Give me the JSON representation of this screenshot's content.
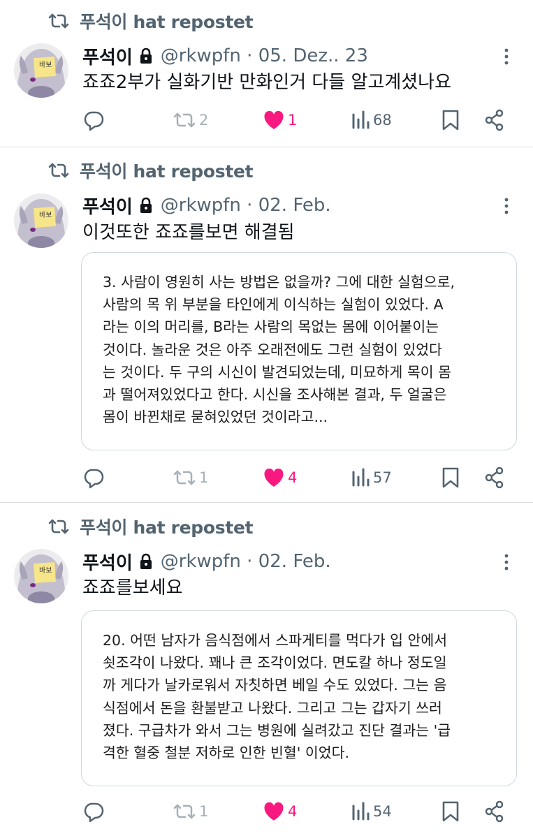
{
  "posts": [
    {
      "repost_label": "푸석이 hat repostet",
      "name": "푸석이",
      "handle": "@rkwpfn · 05. Dez.. 23",
      "text": "죠죠2부가 실화기반 만화인거 다들 알고계셨나요",
      "quote": [],
      "retweets": "2",
      "likes": "1",
      "views": "68",
      "liked": true
    },
    {
      "repost_label": "푸석이 hat repostet",
      "name": "푸석이",
      "handle": "@rkwpfn · 02. Feb.",
      "text": "이것또한 죠죠를보면 해결됨",
      "quote": [
        "3. 사람이 영원히 사는 방법은 없을까? 그에 대한 실험으로,",
        "사람의 목 위 부분을 타인에게 이식하는 실험이 있었다. A",
        "라는 이의 머리를, B라는 사람의 목없는 몸에 이어붙이는",
        "것이다. 놀라운 것은 아주 오래전에도 그런 실험이 있었다",
        "는 것이다. 두 구의 시신이 발견되었는데, 미묘하게 목이 몸",
        "과 떨어져있었다고 한다. 시신을 조사해본 결과, 두 얼굴은",
        "몸이 바뀐채로 묻혀있었던 것이라고..."
      ],
      "retweets": "1",
      "likes": "4",
      "views": "57",
      "liked": true
    },
    {
      "repost_label": "푸석이 hat repostet",
      "name": "푸석이",
      "handle": "@rkwpfn · 02. Feb.",
      "text": "죠죠를보세요",
      "quote": [
        "20. 어떤 남자가 음식점에서 스파게티를 먹다가 입 안에서",
        "쇳조각이 나왔다. 꽤나 큰 조각이었다. 면도칼 하나 정도일",
        "까 게다가 날카로워서 자칫하면 베일 수도 있었다. 그는 음",
        "식점에서 돈을 환불받고 나왔다. 그리고 그는 갑자기 쓰러",
        "졌다. 구급차가 와서 그는 병원에 실려갔고 진단 결과는 '급",
        "격한 혈중 철분 저하로 인한 빈혈' 이었다."
      ],
      "retweets": "1",
      "likes": "4",
      "views": "54",
      "liked": true
    }
  ],
  "avatar_sticky_note": "바보",
  "icons": {
    "repost": "repost-icon",
    "lock": "lock-icon",
    "more": "more-dots-icon",
    "reply": "reply-icon",
    "retweet": "retweet-icon",
    "like": "heart-icon",
    "views": "views-icon",
    "bookmark": "bookmark-icon",
    "share": "share-icon"
  },
  "colors": {
    "text": "#0f1419",
    "secondary": "#536471",
    "like": "#f91880",
    "border": "#cfd9de"
  }
}
